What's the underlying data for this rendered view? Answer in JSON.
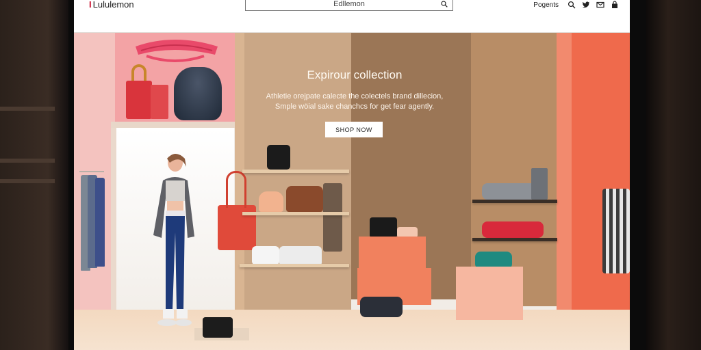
{
  "header": {
    "brand": "Lululemon",
    "search_text": "Edllemon",
    "nav_link": "Pogents",
    "icons": [
      "search-icon",
      "twitter-icon",
      "mail-icon",
      "bag-icon"
    ]
  },
  "hero": {
    "title": "Expirour collection",
    "text_line1": "Athletie orejpate calecte the colectels brand dillecion,",
    "text_line2": "Smple wöial sake chanchcs for get fear agently.",
    "cta_label": "SHOP NOW"
  },
  "colors": {
    "brand_accent": "#c8102e",
    "pink_wall": "#f4c3bf",
    "orange_wall": "#ef6a4c",
    "tan_wall": "#caa786"
  }
}
